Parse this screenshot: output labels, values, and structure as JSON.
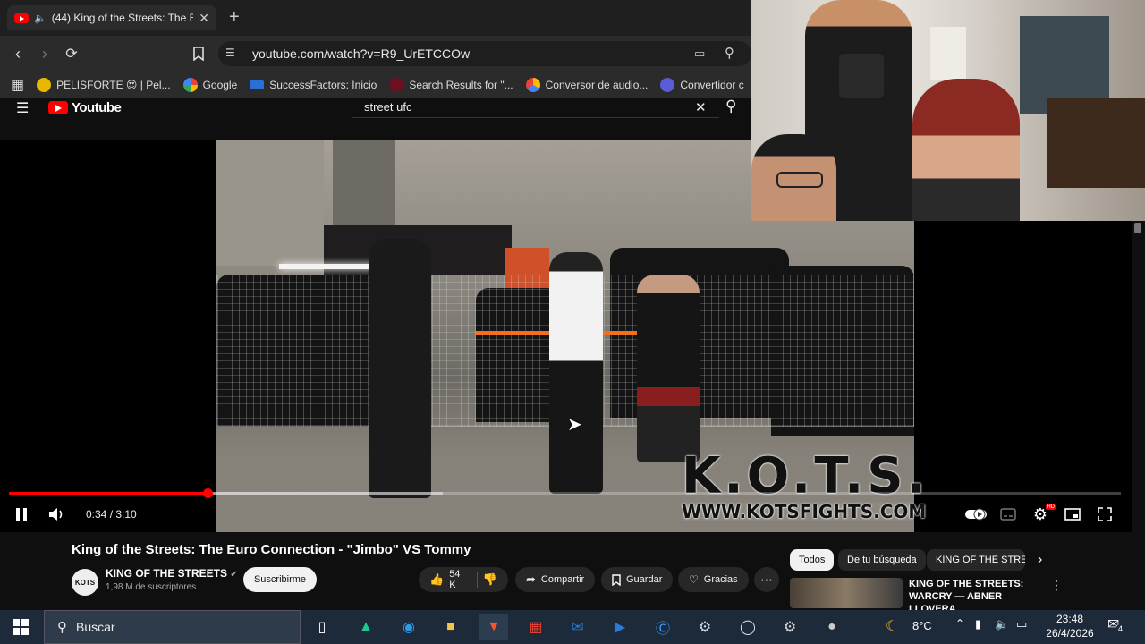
{
  "browser": {
    "tab": {
      "badge": "(44)",
      "title": "King of the Streets: The E",
      "muted_icon": "speaker-icon"
    },
    "url": "youtube.com/watch?v=R9_UrETCCOw",
    "bookmarks": [
      {
        "label": "PELISFORTE 😍 | Pel..."
      },
      {
        "label": "Google"
      },
      {
        "label": "SuccessFactors: Inicio"
      },
      {
        "label": "Search Results for \"..."
      },
      {
        "label": "Conversor de audio..."
      },
      {
        "label": "Convertidor c"
      }
    ]
  },
  "youtube": {
    "logo": "Youtube",
    "search_value": "street ufc",
    "player": {
      "time_current": "0:34",
      "time_total": "3:10",
      "time_display": "0:34 / 3:10",
      "progress_fraction": 0.179,
      "buffered_fraction": 0.39,
      "watermark_big": "K.O.T.S.",
      "watermark_url": "WWW.KOTSFIGHTS.COM",
      "settings_badge": "HD"
    },
    "video_title": "King of the Streets: The Euro Connection - \"Jimbo\" VS Tommy",
    "channel": {
      "avatar_text": "KOTS",
      "name": "KING OF THE STREETS",
      "subscribers": "1,98 M de suscriptores"
    },
    "subscribe_label": "Suscribirme",
    "actions": {
      "likes": "54 K",
      "share": "Compartir",
      "save": "Guardar",
      "thanks": "Gracias"
    },
    "chips": [
      "Todos",
      "De tu búsqueda",
      "KING OF THE STREE"
    ],
    "related": {
      "title": "KING OF THE STREETS: WARCRY — ABNER LLOVERA..."
    }
  },
  "taskbar": {
    "search_placeholder": "Buscar",
    "temperature": "8°C",
    "time": "23:48",
    "date": "26/4/2026",
    "notification_count": "4"
  },
  "colors": {
    "accent": "#ff0000",
    "taskbar": "#1c2a3a",
    "background": "#0f0f0f"
  }
}
